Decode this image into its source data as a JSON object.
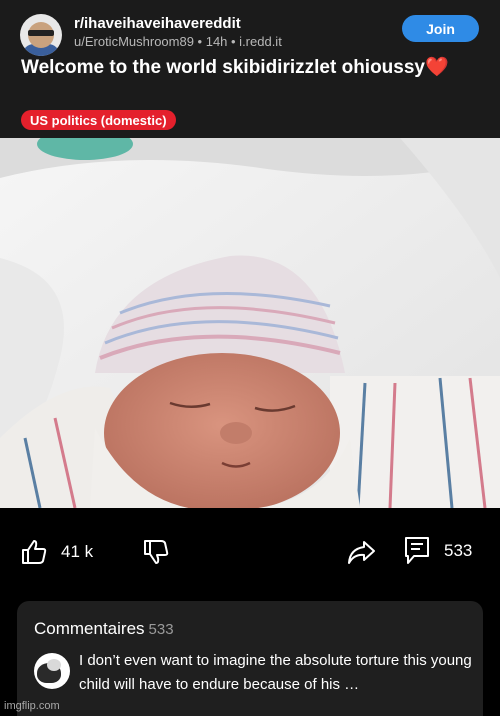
{
  "post": {
    "subreddit": "r/ihaveihaveihavereddit",
    "meta": "u/EroticMushroom89 • 14h • i.redd.it",
    "join_label": "Join",
    "title": "Welcome to the world skibidirizzlet ohioussy",
    "title_emoji": "❤️",
    "flair": "US politics (domestic)"
  },
  "actions": {
    "upvote_count": "41 k",
    "comment_count": "533",
    "icons": [
      "thumbs-up-icon",
      "thumbs-down-icon",
      "share-icon",
      "comment-icon"
    ]
  },
  "comments": {
    "heading": "Commentaires",
    "count": "533",
    "top_comment": "I don’t even want to imagine the absolute torture this young child will have to endure because of his …"
  },
  "watermark": "imgflip.com",
  "colors": {
    "header_bg": "#1b1b1b",
    "join_button": "#2f8be6",
    "flair": "#e4202c",
    "page_bg": "#000000",
    "comments_bg": "#1f1f1f"
  }
}
